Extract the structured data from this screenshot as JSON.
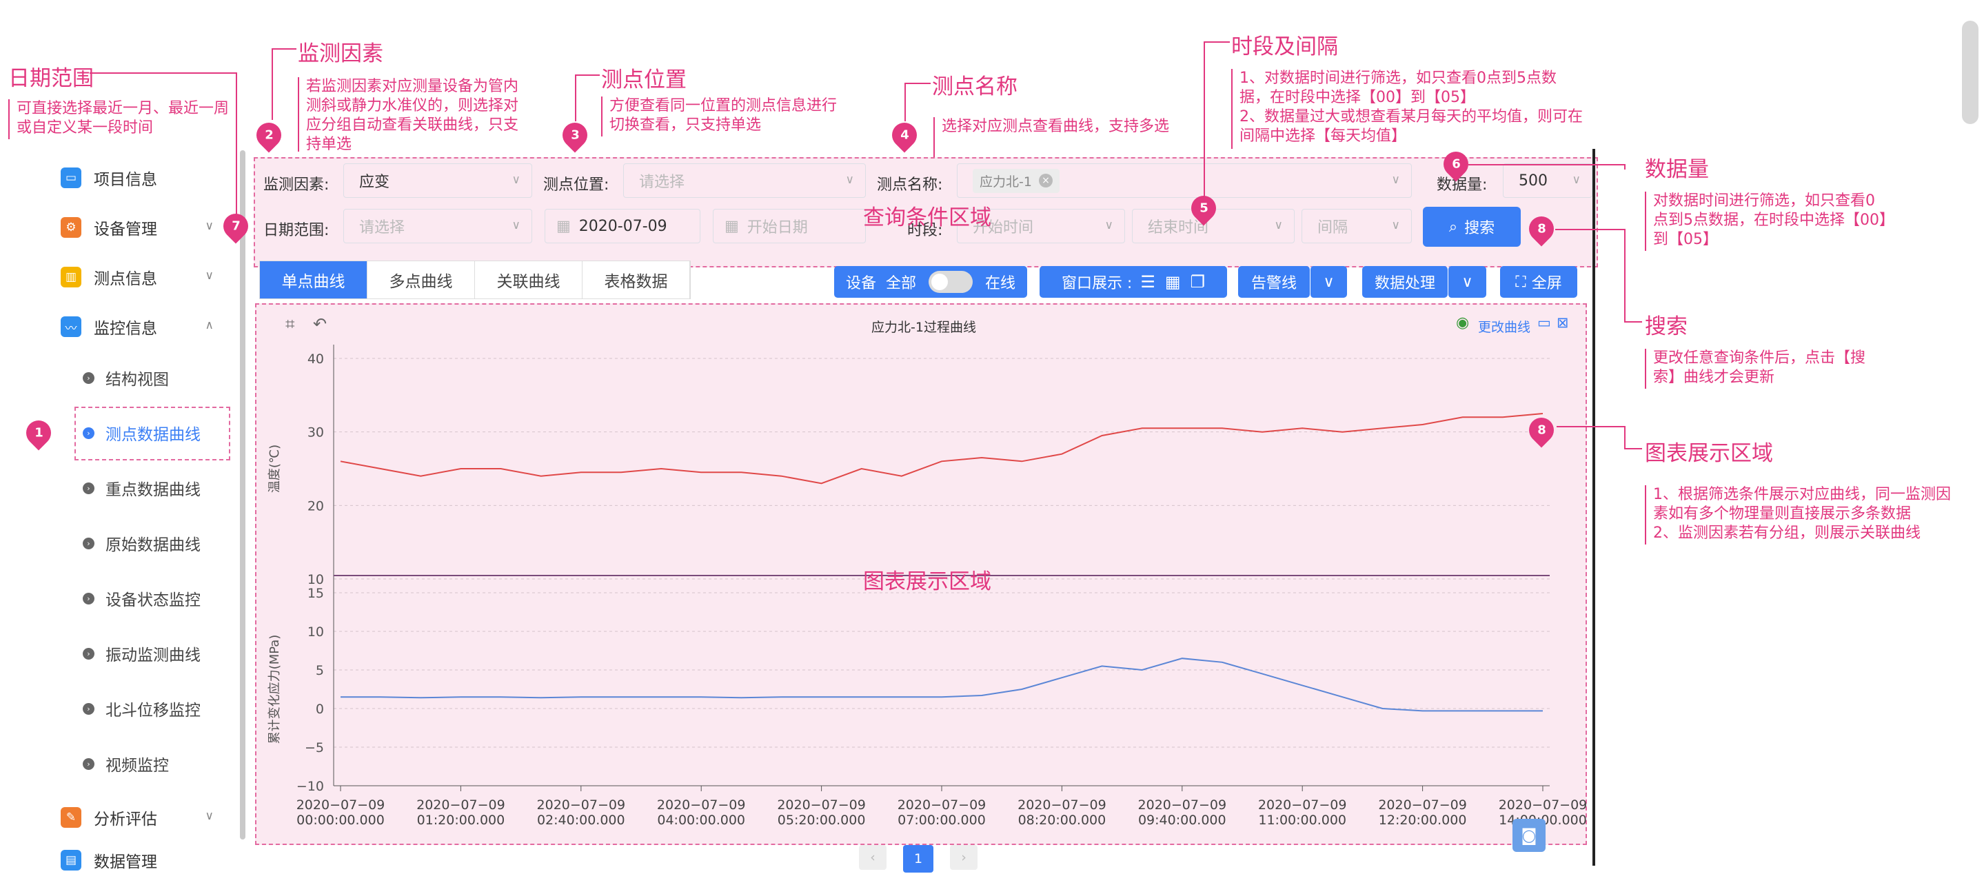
{
  "sidebar": {
    "items": [
      {
        "label": "项目信息",
        "icon": "folder-icon",
        "color": "#2f8ff0"
      },
      {
        "label": "设备管理",
        "icon": "device-icon",
        "color": "#f07c2f"
      },
      {
        "label": "测点信息",
        "icon": "bar-chart-icon",
        "color": "#f5b400"
      },
      {
        "label": "监控信息",
        "icon": "monitor-icon",
        "color": "#2f8ff0"
      },
      {
        "label": "分析评估",
        "icon": "clipboard-icon",
        "color": "#f07c2f"
      },
      {
        "label": "数据管理",
        "icon": "database-icon",
        "color": "#2f8ff0"
      }
    ],
    "sub_items": [
      "结构视图",
      "测点数据曲线",
      "重点数据曲线",
      "原始数据曲线",
      "设备状态监控",
      "振动监测曲线",
      "北斗位移监控",
      "视频监控"
    ]
  },
  "query": {
    "factor_label": "监测因素:",
    "factor_value": "应变",
    "location_label": "测点位置:",
    "location_placeholder": "请选择",
    "name_label": "测点名称:",
    "name_tag": "应力北-1",
    "count_label": "数据量:",
    "count_value": "500",
    "date_label": "日期范围:",
    "date_placeholder": "请选择",
    "date_value": "2020-07-09",
    "start_date_placeholder": "开始日期",
    "period_label": "时段:",
    "start_time_placeholder": "开始时间",
    "end_time_placeholder": "结束时间",
    "interval_placeholder": "间隔",
    "search_button": "搜索",
    "area_label": "查询条件区域"
  },
  "tabs": [
    "单点曲线",
    "多点曲线",
    "关联曲线",
    "表格数据"
  ],
  "toolbar": {
    "device_label": "设备",
    "all_label": "全部",
    "online_label": "在线",
    "window_label": "窗口展示 :",
    "alarm_label": "告警线",
    "process_label": "数据处理",
    "fullscreen_label": "全屏"
  },
  "pagination": {
    "current": "1"
  },
  "annotations": {
    "date_range_title": "日期范围",
    "date_range_text": "可直接选择最近一月、最近一周或自定义某一段时间",
    "factor_title": "监测因素",
    "factor_text": "若监测因素对应测量设备为管内测斜或静力水准仪的，则选择对应分组自动查看关联曲线，只支持单选",
    "location_title": "测点位置",
    "location_text": "方便查看同一位置的测点信息进行切换查看，只支持单选",
    "name_title": "测点名称",
    "name_text": "选择对应测点查看曲线，支持多选",
    "period_title": "时段及间隔",
    "period_text_1": "1、对数据时间进行筛选，如只查看0点到5点数据，在时段中选择【00】到【05】",
    "period_text_2": "2、数据量过大或想查看某月每天的平均值，则可在间隔中选择【每天均值】",
    "count_title": "数据量",
    "count_text": "对数据时间进行筛选，如只查看0点到5点数据，在时段中选择【00】到【05】",
    "search_title": "搜索",
    "search_text": "更改任意查询条件后，点击【搜索】曲线才会更新",
    "chart_title": "图表展示区域",
    "chart_text_1": "1、根据筛选条件展示对应曲线，同一监测因素如有多个物理量则直接展示多条数据",
    "chart_text_2": "2、监测因素若有分组，则展示关联曲线",
    "markers": [
      "1",
      "2",
      "3",
      "4",
      "5",
      "6",
      "7",
      "8",
      "8"
    ]
  },
  "chart_data": {
    "type": "line",
    "title": "应力北-1过程曲线",
    "edit_label": "更改曲线",
    "area_label": "图表展示区域",
    "x": [
      "2020-07-09 00:00:00.000",
      "2020-07-09 01:20:00.000",
      "2020-07-09 02:40:00.000",
      "2020-07-09 04:00:00.000",
      "2020-07-09 05:20:00.000",
      "2020-07-09 07:00:00.000",
      "2020-07-09 08:20:00.000",
      "2020-07-09 09:40:00.000",
      "2020-07-09 11:00:00.000",
      "2020-07-09 12:20:00.000",
      "2020-07-09 14:00:00.000"
    ],
    "panels": [
      {
        "ylabel": "温度(℃)",
        "ylim": [
          10,
          40
        ],
        "yticks": [
          10,
          20,
          30,
          40
        ],
        "color": "#e04848",
        "series": [
          {
            "values": [
              26,
              25,
              24,
              25,
              25,
              24,
              24.5,
              24.5,
              25,
              24.5,
              24.5,
              24,
              23,
              25,
              24,
              26,
              26.5,
              26,
              27,
              29.5,
              30.5,
              30.5,
              30.5,
              30,
              30.5,
              30,
              30.5,
              31,
              32,
              32,
              32.5
            ]
          }
        ]
      },
      {
        "ylabel": "累计变化应力(MPa)",
        "ylim": [
          -10,
          15
        ],
        "yticks": [
          -10,
          -5,
          0,
          5,
          10,
          15
        ],
        "color": "#5b86d6",
        "series": [
          {
            "values": [
              1.5,
              1.5,
              1.4,
              1.5,
              1.5,
              1.4,
              1.5,
              1.5,
              1.5,
              1.5,
              1.4,
              1.5,
              1.5,
              1.5,
              1.5,
              1.5,
              1.7,
              2.5,
              4,
              5.5,
              5,
              6.5,
              6,
              4.5,
              3,
              1.5,
              0,
              -0.3,
              -0.3,
              -0.3,
              -0.3
            ]
          }
        ]
      }
    ]
  }
}
